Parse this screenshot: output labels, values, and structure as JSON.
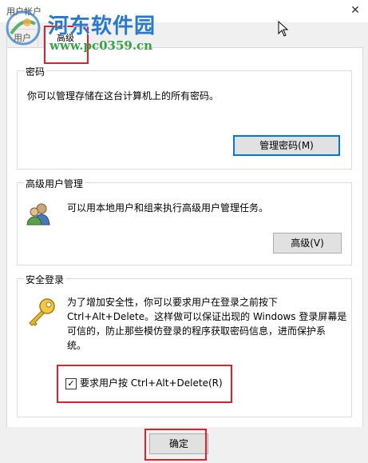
{
  "window": {
    "title": "用户帐户",
    "close_glyph": "✕"
  },
  "watermark": {
    "name": "河东软件园",
    "url": "www.pc0359.cn"
  },
  "tabs": [
    {
      "label": "用户"
    },
    {
      "label": "高级"
    }
  ],
  "passwords": {
    "group_label": "密码",
    "description": "你可以管理存储在这台计算机上的所有密码。",
    "button": "管理密码(M)"
  },
  "advanced_user_mgmt": {
    "group_label": "高级用户管理",
    "description": "可以用本地用户和组来执行高级用户管理任务。",
    "button": "高级(V)",
    "icon": "users-icon"
  },
  "secure_logon": {
    "group_label": "安全登录",
    "line1": "为了增加安全性，你可以要求用户在登录之前按下",
    "line2": "Ctrl+Alt+Delete。这样做可以保证出现的 Windows 登录屏幕是",
    "line3": "可信的，防止那些模仿登录的程序获取密码信息，进而保护系",
    "line4": "统。",
    "checkbox_label": "要求用户按 Ctrl+Alt+Delete(R)",
    "checkbox_checked": true,
    "check_glyph": "✓",
    "icon": "key-icon"
  },
  "footer": {
    "ok_button": "确定"
  },
  "colors": {
    "accent": "#0078d7",
    "highlight": "#e0202a"
  }
}
